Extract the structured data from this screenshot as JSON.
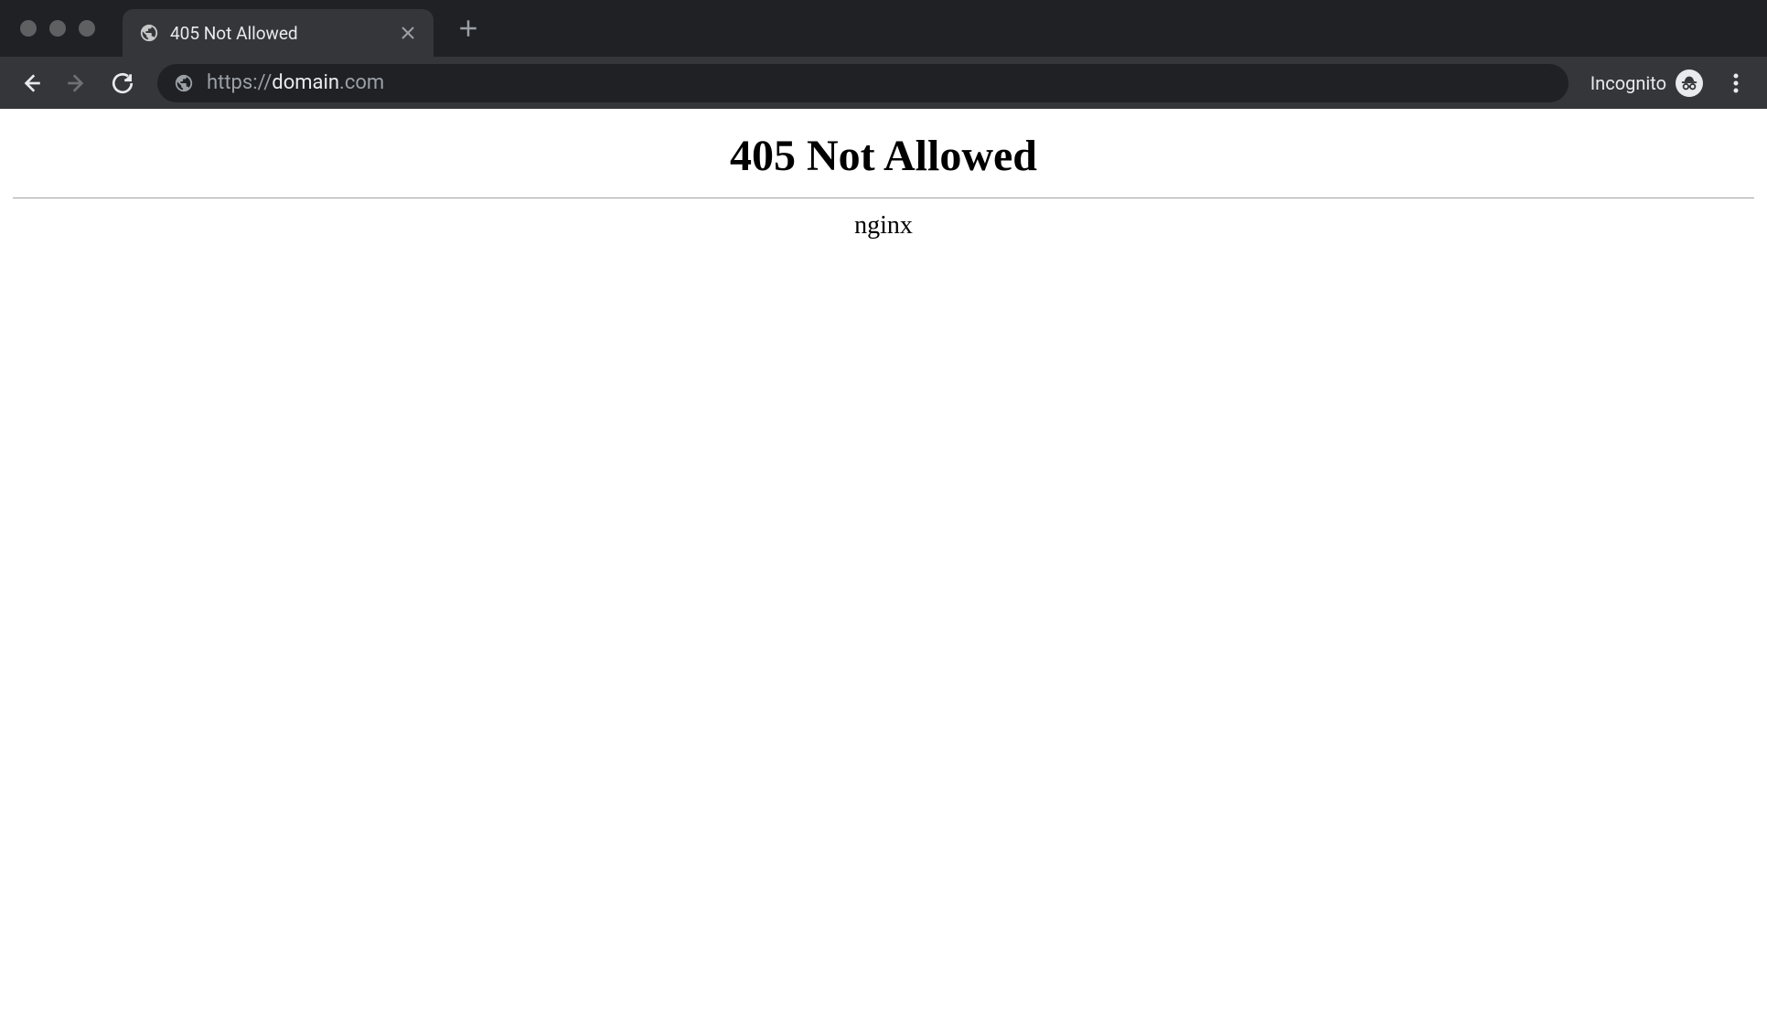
{
  "browser": {
    "tab": {
      "title": "405 Not Allowed"
    },
    "url": {
      "scheme": "https://",
      "host": "domain",
      "tld": ".com"
    },
    "incognito_label": "Incognito"
  },
  "page": {
    "heading": "405 Not Allowed",
    "server": "nginx"
  }
}
